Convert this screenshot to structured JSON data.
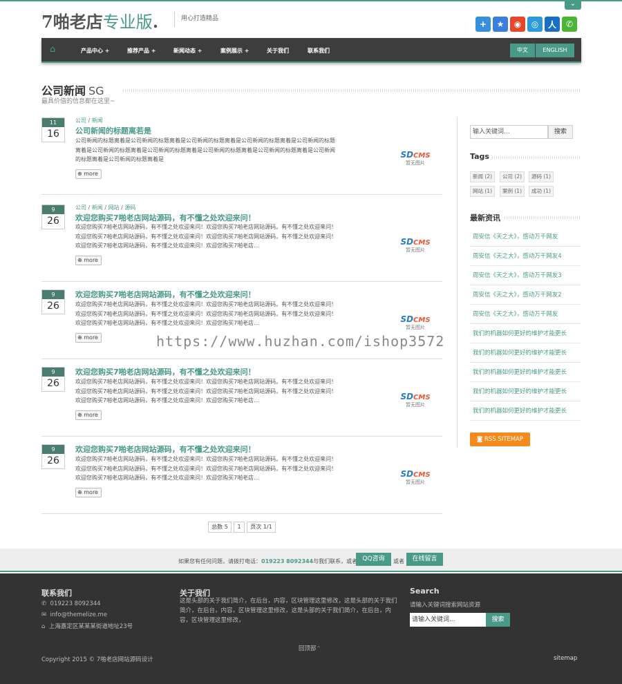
{
  "header": {
    "logo_main": "7啪老店",
    "logo_pro": "专业版",
    "logo_dot": ".",
    "slogan": "用心打造精品",
    "social_icons": [
      "plus-icon",
      "star-icon",
      "weibo-icon",
      "tencent-weibo-icon",
      "renren-icon",
      "wechat-icon"
    ]
  },
  "nav": {
    "items": [
      "产品中心 +",
      "推荐产品 +",
      "新闻动态 +",
      "案例展示 +",
      "关于我们",
      "联系我们"
    ],
    "lang_cn": "中文",
    "lang_en": "ENGLISH"
  },
  "section": {
    "title": "公司新闻",
    "title_suffix": "SG",
    "subtitle": "最具价值的信息都在这里~"
  },
  "posts": [
    {
      "month": "11",
      "day": "16",
      "cats": [
        "公司",
        "新闻"
      ],
      "title": "公司新闻的标题离若是",
      "lines": [
        "公司新闻的标题离着是公司新闻的标题离着是公司新闻的标题离着是公司新闻的标题离着是公司新闻的标题",
        "离着是公司新闻的标题离着是公司新闻的标题离着是公司新闻的标题离着是公司新闻的标题离着是公司新闻",
        "的标题离着是公司新闻的标题离着是"
      ]
    },
    {
      "month": "9",
      "day": "26",
      "cats": [
        "公司",
        "新闻",
        "网站",
        "源码"
      ],
      "title": "欢迎您购买7啪老店网站源码，有不懂之处欢迎来问！",
      "lines": [
        "欢迎您购买7啪老店网站源码，有不懂之处欢迎来问！欢迎您购买7啪老店网站源码，有不懂之处欢迎来问！",
        "欢迎您购买7啪老店网站源码，有不懂之处欢迎来问！欢迎您购买7啪老店网站源码，有不懂之处欢迎来问！",
        "欢迎您购买7啪老店网站源码，有不懂之处欢迎来问！欢迎您购买7啪老店..."
      ]
    },
    {
      "month": "9",
      "day": "26",
      "cats": [],
      "title": "欢迎您购买7啪老店网站源码，有不懂之处欢迎来问！",
      "lines": [
        "欢迎您购买7啪老店网站源码，有不懂之处欢迎来问！欢迎您购买7啪老店网站源码，有不懂之处欢迎来问！",
        "欢迎您购买7啪老店网站源码，有不懂之处欢迎来问！欢迎您购买7啪老店网站源码，有不懂之处欢迎来问！",
        "欢迎您购买7啪老店网站源码，有不懂之处欢迎来问！欢迎您购买7啪老店..."
      ]
    },
    {
      "month": "9",
      "day": "26",
      "cats": [],
      "title": "欢迎您购买7啪老店网站源码，有不懂之处欢迎来问！",
      "lines": [
        "欢迎您购买7啪老店网站源码，有不懂之处欢迎来问！欢迎您购买7啪老店网站源码，有不懂之处欢迎来问！",
        "欢迎您购买7啪老店网站源码，有不懂之处欢迎来问！欢迎您购买7啪老店网站源码，有不懂之处欢迎来问！",
        "欢迎您购买7啪老店网站源码，有不懂之处欢迎来问！欢迎您购买7啪老店..."
      ]
    },
    {
      "month": "9",
      "day": "26",
      "cats": [],
      "title": "欢迎您购买7啪老店网站源码，有不懂之处欢迎来问！",
      "lines": [
        "欢迎您购买7啪老店网站源码，有不懂之处欢迎来问！欢迎您购买7啪老店网站源码，有不懂之处欢迎来问！",
        "欢迎您购买7啪老店网站源码，有不懂之处欢迎来问！欢迎您购买7啪老店网站源码，有不懂之处欢迎来问！",
        "欢迎您购买7啪老店网站源码，有不懂之处欢迎来问！欢迎您购买7啪老店..."
      ]
    }
  ],
  "more_label": "more",
  "thumb": {
    "sd": "SD",
    "cms": "CMS",
    "noimg": "暂无图片"
  },
  "pager": {
    "total": "总数 5",
    "page": "1",
    "pages": "页次 1/1"
  },
  "sidebar": {
    "search_placeholder": "输入关键词...",
    "search_btn": "搜索",
    "tags_title": "Tags",
    "tags": [
      "新闻 (2)",
      "公司 (2)",
      "源码 (1)",
      "网站 (1)",
      "案例 (1)",
      "成功 (1)"
    ],
    "news_title": "最新资讯",
    "news": [
      "周安信《天之大》，感动万千网友",
      "周安信《天之大》，感动万千网友4",
      "周安信《天之大》，感动万千网友3",
      "周安信《天之大》，感动万千网友2",
      "周安信《天之大》，感动万千网友",
      "我们的机器如何更好的维护才能更长",
      "我们的机器如何更好的维护才能更长",
      "我们的机器如何更好的维护才能更长",
      "我们的机器如何更好的维护才能更长",
      "我们的机器如何更好的维护才能更长"
    ],
    "rss": "RSS SITEMAP"
  },
  "watermark": "https://www.huzhan.com/ishop3572",
  "cta": {
    "text1": "如果您有任何问题，请拨打电话：",
    "phone": "019223 8092344",
    "text2": "与我们联系，或者",
    "qq": "QQ咨询",
    "or": "或者",
    "msg": "在线留言"
  },
  "footer": {
    "contact_title": "联系我们",
    "phone": "019223 8092344",
    "email": "info@themelize.me",
    "address": "上海嘉定区某某某街道地址23号",
    "about_title": "关于我们",
    "about_text": "这是头部的关于我们简介，在后台，内容，区块管理这里修改，这是头部的关于我们简介，在后台，内容，区块管理这里修改，这是头部的关于我们简介，在后台，内容，区块管理这里修改，",
    "search_title": "Search",
    "search_sub": "请输入关键词搜索网站资源",
    "search_placeholder": "请输入关键词...",
    "search_btn": "搜索",
    "backtop": "回顶部",
    "copyright": "Copyright 2015 © 7啪老店网站源码设计",
    "sitemap": "sitemap"
  }
}
